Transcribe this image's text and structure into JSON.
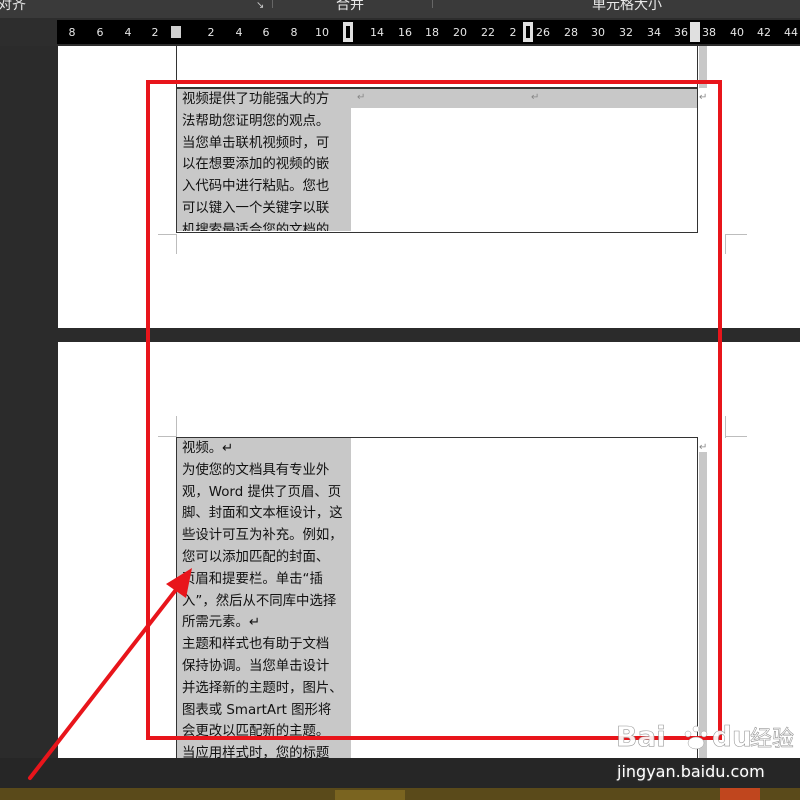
{
  "ribbon": {
    "item1": "调整对齐",
    "item2": "合并",
    "item3": "单元格大小"
  },
  "ruler": {
    "ticks": [
      "8",
      "6",
      "4",
      "2",
      "2",
      "4",
      "6",
      "8",
      "10",
      "14",
      "16",
      "18",
      "20",
      "22",
      "2",
      "26",
      "28",
      "30",
      "32",
      "34",
      "36",
      "38",
      "40",
      "42",
      "44"
    ]
  },
  "cell1": {
    "text": "视频提供了功能强大的方\n法帮助您证明您的观点。\n当您单击联机视频时，可\n以在想要添加的视频的嵌\n入代码中进行粘贴。您也\n可以键入一个关键字以联\n机搜索最适合您的文档的"
  },
  "cell2": {
    "text": "视频。↵\n为使您的文档具有专业外\n观，Word 提供了页眉、页\n脚、封面和文本框设计，这\n些设计可互为补充。例如，\n您可以添加匹配的封面、\n页眉和提要栏。单击“插\n入”，然后从不同库中选择\n所需元素。↵\n主题和样式也有助于文档\n保持协调。当您单击设计\n并选择新的主题时，图片、\n图表或 SmartArt 图形将\n会更改以匹配新的主题。\n当应用样式时，您的标题\n会进行更改以匹配新的主"
  },
  "marks": {
    "para": "↵"
  },
  "watermark": {
    "brand": "Bai du 经验",
    "site": "jingyan.baidu.com"
  },
  "colors": {
    "highlight": "#e8151b",
    "cell_shading": "#c8c8c8"
  }
}
